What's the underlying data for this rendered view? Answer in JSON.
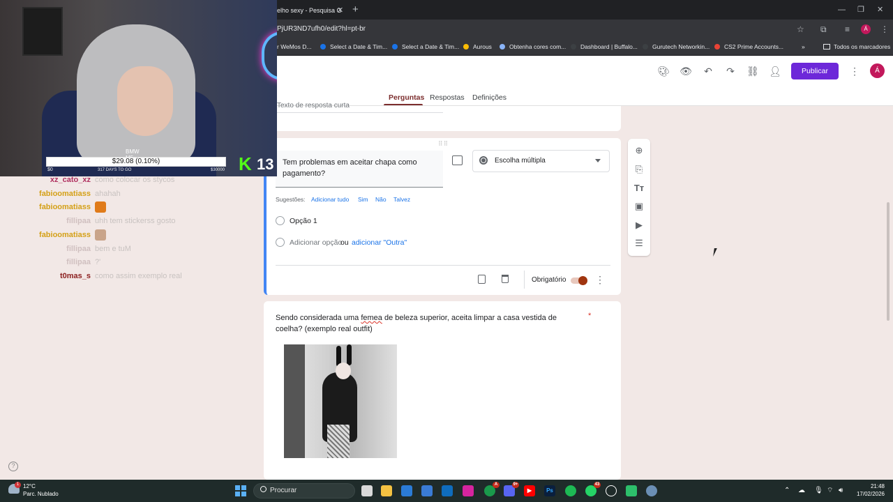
{
  "browser": {
    "tab_title": "elho sexy - Pesquisa G",
    "url": "PjUR3ND7ufh0/edit?hl=pt-br",
    "bookmarks": [
      {
        "label": "r WeMos D...",
        "color": "#e8eaed"
      },
      {
        "label": "Select a Date & Tim...",
        "color": "#1a73e8"
      },
      {
        "label": "Select a Date & Tim...",
        "color": "#1a73e8"
      },
      {
        "label": "Aurous",
        "color": "#fbbc04"
      },
      {
        "label": "Obtenha cores com...",
        "color": "#8ab4f8"
      },
      {
        "label": "Dashboard | Buffalo...",
        "color": "#3c4043"
      },
      {
        "label": "Gurutech Networkin...",
        "color": "#3c4043"
      },
      {
        "label": "CS2 Prime Accounts...",
        "color": "#ea4335"
      }
    ],
    "all_bookmarks": "Todos os marcadores"
  },
  "webcam": {
    "car_label": "BMW M5",
    "goal_price": "$29.08 (0.10%)",
    "days_to_go": "317 DAYS TO GO",
    "min": "$0",
    "max": "$30000",
    "kick_count": "13"
  },
  "chat": [
    {
      "name": "xz_cato_xz",
      "name_color": "#b03060",
      "message": "como colocar os stycos",
      "emote": null
    },
    {
      "name": "fabioomatiass",
      "name_color": "#d4a017",
      "message": "ahahah",
      "emote": null
    },
    {
      "name": "fabioomatiass",
      "name_color": "#d4a017",
      "message": "",
      "emote": "#e07b1a"
    },
    {
      "name": "fillipaa",
      "name_color": "#d0c0c0",
      "message": "uhh tem stickerss gosto",
      "emote": null
    },
    {
      "name": "fabioomatiass",
      "name_color": "#d4a017",
      "message": "",
      "emote": "#c9a48a"
    },
    {
      "name": "fillipaa",
      "name_color": "#d0c0c0",
      "message": "bem e tuM",
      "emote": null
    },
    {
      "name": "fillipaa",
      "name_color": "#d0c0c0",
      "message": "?'",
      "emote": null
    },
    {
      "name": "t0mas_s",
      "name_color": "#8b1e1e",
      "message": "como assim exemplo real",
      "emote": null
    }
  ],
  "forms": {
    "publish": "Publicar",
    "avatar": "Á",
    "tabs": [
      "Perguntas",
      "Respostas",
      "Definições"
    ],
    "short_answer_placeholder": "Texto de resposta curta",
    "question1": {
      "title": "Tem problemas em aceitar chapa como pagamento?",
      "type": "Escolha múltipla",
      "suggestions_label": "Sugestões:",
      "suggestions": [
        "Adicionar tudo",
        "Sim",
        "Não",
        "Talvez"
      ],
      "option1": "Opção 1",
      "add_option": "Adicionar opção",
      "or": "ou",
      "add_other": "adicionar \"Outra\"",
      "required_label": "Obrigatório"
    },
    "question2": {
      "title_before": "Sendo considerada uma ",
      "title_misspelled": "femea",
      "title_after": " de beleza superior, aceita limpar a casa vestida de coelha? (exemplo real outfit)",
      "required_mark": "*"
    }
  },
  "taskbar": {
    "temperature": "12°C",
    "condition": "Parc. Nublado",
    "search_placeholder": "Procurar",
    "time": "21:48",
    "date": "17/02/2026"
  }
}
